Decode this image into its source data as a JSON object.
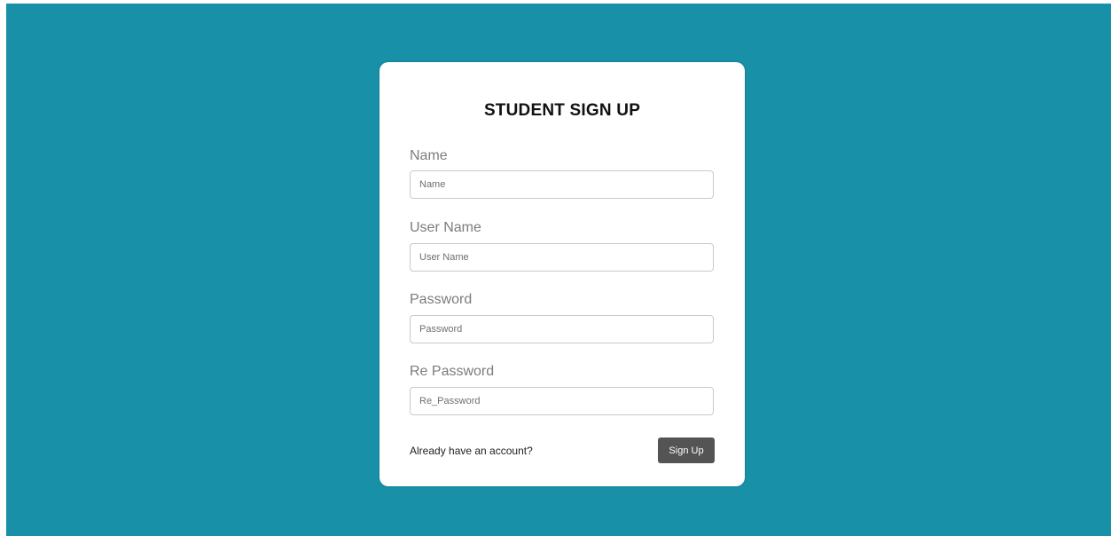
{
  "form": {
    "title": "STUDENT SIGN UP",
    "fields": [
      {
        "label": "Name",
        "placeholder": "Name",
        "value": ""
      },
      {
        "label": "User Name",
        "placeholder": "User Name",
        "value": ""
      },
      {
        "label": "Password",
        "placeholder": "Password",
        "value": ""
      },
      {
        "label": "Re Password",
        "placeholder": "Re_Password",
        "value": ""
      }
    ],
    "login_prompt": "Already have an account?",
    "submit_label": "Sign Up"
  },
  "colors": {
    "background": "#1890a8",
    "card": "#ffffff",
    "button": "#545454"
  }
}
